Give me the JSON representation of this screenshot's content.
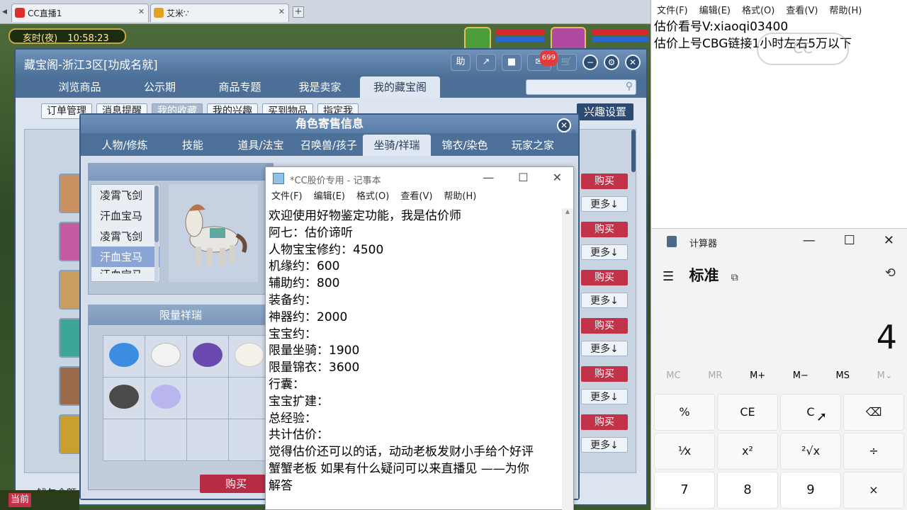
{
  "browser": {
    "tabs": [
      {
        "title": "CC直播1"
      },
      {
        "title": "艾米∵"
      }
    ],
    "new_tab_label": "+"
  },
  "game": {
    "time_label": "亥时(夜)",
    "time_value": "10:58:23"
  },
  "cbg": {
    "title": "藏宝阁-浙江3区[功成名就]",
    "help_label": "助",
    "badge_count": "699",
    "nav_tabs": [
      "浏览商品",
      "公示期",
      "商品专题",
      "我是卖家",
      "我的藏宝阁"
    ],
    "active_nav": "我的藏宝阁",
    "subnav": [
      "订单管理",
      "消息提醒",
      "我的收藏",
      "我的兴趣",
      "买到物品",
      "指定我"
    ],
    "interest_button": "兴趣设置",
    "buy_label": "购买",
    "more_label": "更多↓",
    "wallet_label": "钱包余额"
  },
  "dialog": {
    "title": "角色寄售信息",
    "tabs": [
      "人物/修炼",
      "技能",
      "道具/法宝",
      "召唤兽/孩子",
      "坐骑/祥瑞",
      "锦衣/染色",
      "玩家之家"
    ],
    "active_tab": "坐骑/祥瑞",
    "mounts": [
      "凌霄飞剑",
      "汗血宝马",
      "凌霄飞剑",
      "汗血宝马",
      "汗血宝马"
    ],
    "selected_mount_index": 3,
    "limited_header": "限量祥瑞",
    "buy_button": "购买"
  },
  "notepad": {
    "title": "*CC股价专用 - 记事本",
    "menu": [
      "文件(F)",
      "编辑(E)",
      "格式(O)",
      "查看(V)",
      "帮助(H)"
    ],
    "lines": [
      "欢迎使用好物鉴定功能，我是估价师",
      "阿七：估价谛听",
      "人物宝宝修约：4500",
      "机缘约：600",
      "辅助约：800",
      "装备约：",
      "神器约：2000",
      "宝宝约：",
      "限量坐骑：1900",
      "限量锦衣：3600",
      "行囊：",
      "宝宝扩建：",
      "总经验：",
      "共计估价：",
      "觉得估价还可以的话，动动老板发财小手给个好评",
      "蟹蟹老板 如果有什么疑问可以来直播见 ——为你",
      "解答"
    ]
  },
  "notepad2": {
    "menu": [
      "文件(F)",
      "编辑(E)",
      "格式(O)",
      "查看(V)",
      "帮助(H)"
    ],
    "line1": "估价看号V:xiaoqi03400",
    "line2": "估价上号CBG链接1小时左右5万以下",
    "watermark": "CC"
  },
  "calculator": {
    "title": "计算器",
    "mode": "标准",
    "display": "4",
    "memory": [
      "MC",
      "MR",
      "M+",
      "M−",
      "MS",
      "M⌄"
    ],
    "keys": [
      "%",
      "CE",
      "C",
      "⌫",
      "¹⁄x",
      "x²",
      "²√x",
      "÷",
      "7",
      "8",
      "9",
      "×"
    ]
  },
  "bottom_bar": {
    "current_label": "当前"
  }
}
